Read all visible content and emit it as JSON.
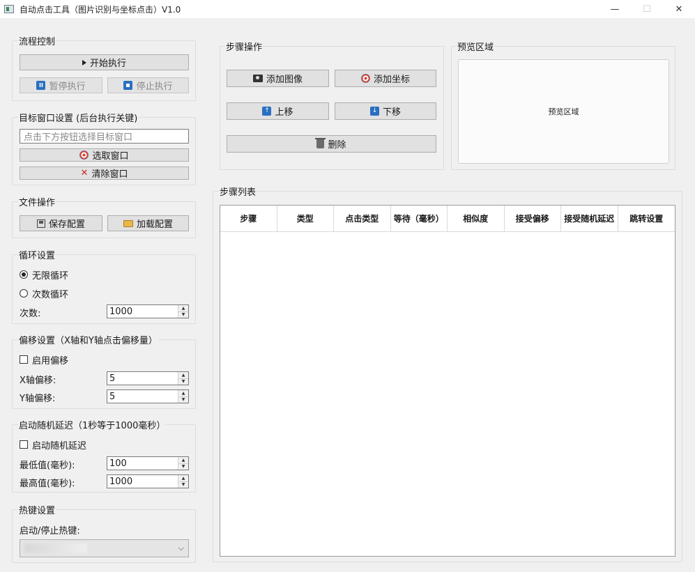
{
  "window": {
    "title": "自动点击工具（图片识别与坐标点击）V1.0",
    "minimize": "—",
    "maximize": "☐",
    "close": "✕"
  },
  "flow": {
    "title": "流程控制",
    "start": "开始执行",
    "pause": "暂停执行",
    "stop": "停止执行"
  },
  "target": {
    "title": "目标窗口设置 (后台执行关键)",
    "placeholder": "点击下方按钮选择目标窗口",
    "select": "选取窗口",
    "clear": "清除窗口"
  },
  "file": {
    "title": "文件操作",
    "save": "保存配置",
    "load": "加载配置"
  },
  "loop": {
    "title": "循环设置",
    "infinite": "无限循环",
    "count_mode": "次数循环",
    "count_label": "次数:",
    "count_value": "1000",
    "selected": "infinite"
  },
  "offset": {
    "title": "偏移设置（X轴和Y轴点击偏移量）",
    "enable": "启用偏移",
    "enabled": false,
    "x_label": "X轴偏移:",
    "x_value": "5",
    "y_label": "Y轴偏移:",
    "y_value": "5"
  },
  "delay": {
    "title": "启动随机延迟（1秒等于1000毫秒）",
    "enable": "启动随机延迟",
    "enabled": false,
    "min_label": "最低值(毫秒):",
    "min_value": "100",
    "max_label": "最高值(毫秒):",
    "max_value": "1000"
  },
  "hotkey": {
    "title": "热键设置",
    "label": "启动/停止热键:"
  },
  "steps_ops": {
    "title": "步骤操作",
    "add_image": "添加图像",
    "add_coord": "添加坐标",
    "move_up": "上移",
    "move_down": "下移",
    "delete": "删除"
  },
  "preview": {
    "title": "预览区域",
    "text": "预览区域"
  },
  "step_list": {
    "title": "步骤列表",
    "columns": [
      "步骤",
      "类型",
      "点击类型",
      "等待（毫秒）",
      "相似度",
      "接受偏移",
      "接受随机延迟",
      "跳转设置"
    ]
  }
}
